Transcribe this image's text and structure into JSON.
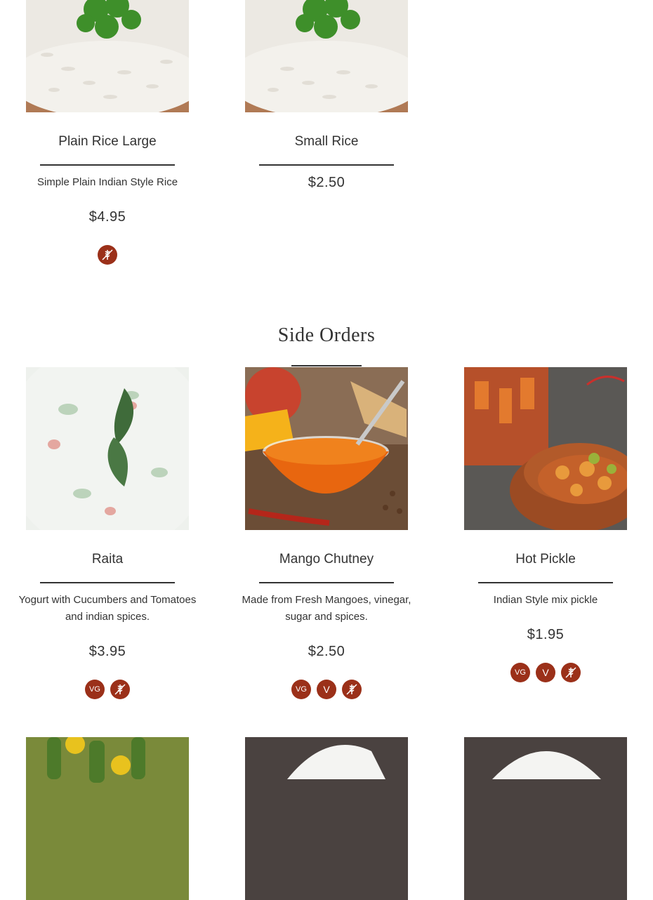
{
  "rice_items": [
    {
      "name": "Plain Rice Large",
      "description": "Simple Plain Indian Style Rice",
      "price": "$4.95",
      "badges": [
        "gluten-free"
      ]
    },
    {
      "name": "Small Rice",
      "description": "",
      "price": "$2.50",
      "badges": []
    }
  ],
  "side_orders": {
    "title": "Side Orders",
    "items": [
      {
        "name": "Raita",
        "description": "Yogurt with Cucumbers and Tomatoes and indian spices.",
        "price": "$3.95",
        "badges": [
          "VG",
          "gluten-free"
        ]
      },
      {
        "name": "Mango Chutney",
        "description": "Made from Fresh Mangoes, vinegar, sugar and spices.",
        "price": "$2.50",
        "badges": [
          "VG",
          "V",
          "gluten-free"
        ]
      },
      {
        "name": "Hot Pickle",
        "description": "Indian Style mix pickle",
        "price": "$1.95",
        "badges": [
          "VG",
          "V",
          "gluten-free"
        ]
      }
    ]
  },
  "badge_labels": {
    "vegan": "VG",
    "vegetarian": "V"
  },
  "icons": {
    "gluten_free": "wheat-crossed-icon"
  },
  "colors": {
    "badge": "#9b3019",
    "text": "#333333"
  }
}
